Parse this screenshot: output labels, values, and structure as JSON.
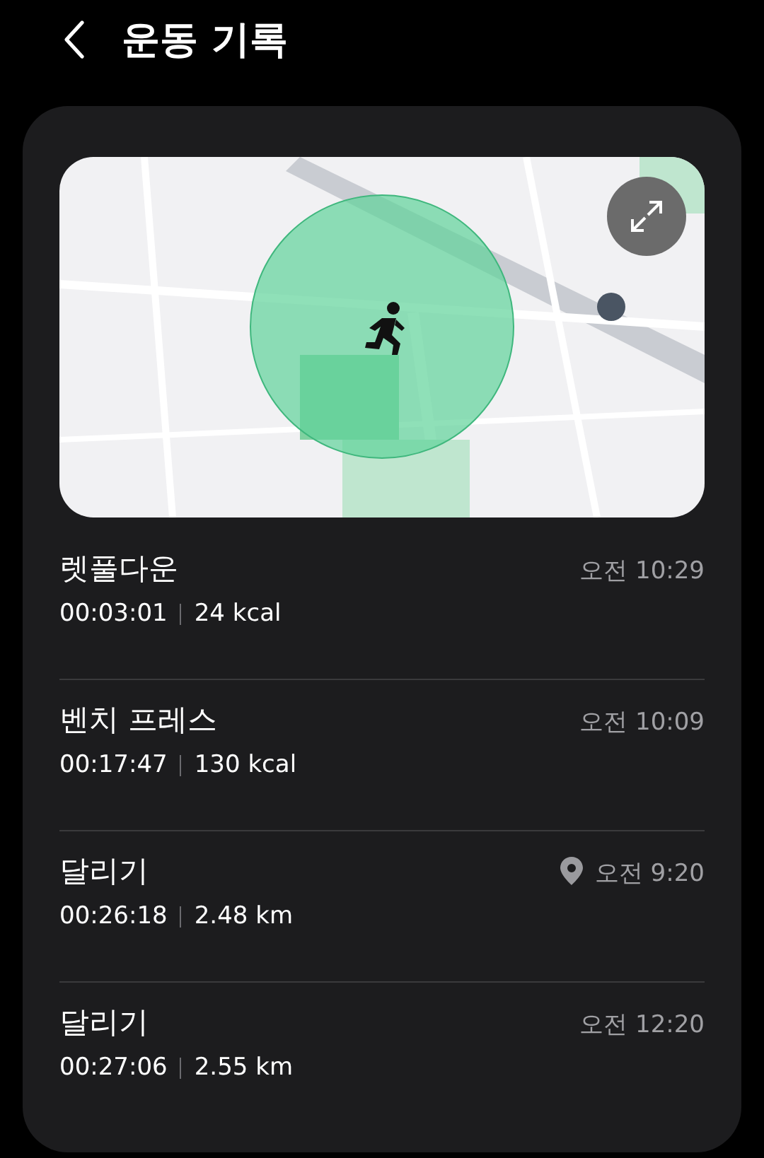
{
  "header": {
    "title": "운동 기록"
  },
  "workouts": [
    {
      "name": "렛풀다운",
      "duration": "00:03:01",
      "metric": "24 kcal",
      "time": "오전 10:29",
      "has_location": false
    },
    {
      "name": "벤치 프레스",
      "duration": "00:17:47",
      "metric": "130 kcal",
      "time": "오전 10:09",
      "has_location": false
    },
    {
      "name": "달리기",
      "duration": "00:26:18",
      "metric": "2.48 km",
      "time": "오전 9:20",
      "has_location": true
    },
    {
      "name": "달리기",
      "duration": "00:27:06",
      "metric": "2.55 km",
      "time": "오전 12:20",
      "has_location": false
    }
  ]
}
